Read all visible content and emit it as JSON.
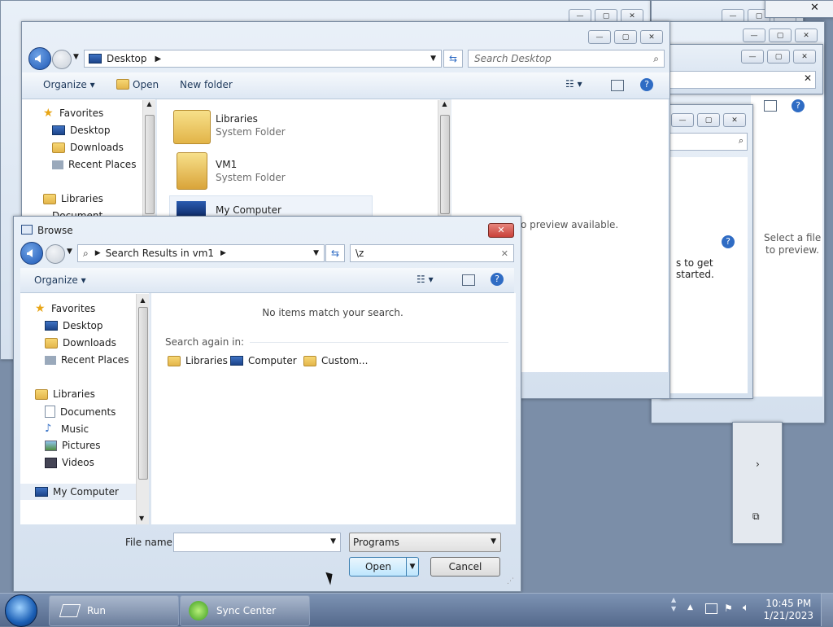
{
  "back_window": {
    "address": "Desktop",
    "search_placeholder": "Search Desktop",
    "toolbar": {
      "organize": "Organize",
      "open": "Open",
      "new_folder": "New folder"
    },
    "nav": {
      "favorites": "Favorites",
      "desktop": "Desktop",
      "downloads": "Downloads",
      "recent": "Recent Places",
      "libraries": "Libraries",
      "documents_partial": "Document"
    },
    "files": [
      {
        "name": "Libraries",
        "type": "System Folder"
      },
      {
        "name": "VM1",
        "type": "System Folder"
      },
      {
        "name": "My Computer",
        "type": ""
      }
    ],
    "preview_text": "No preview available."
  },
  "side_windows": {
    "select_file_1": "Select a file",
    "select_file_2": "to preview.",
    "get_started": "s to get started."
  },
  "browse_dialog": {
    "title": "Browse",
    "breadcrumb": "Search Results in vm1",
    "search_value": "\\z",
    "toolbar": {
      "organize": "Organize"
    },
    "nav": {
      "favorites": "Favorites",
      "desktop": "Desktop",
      "downloads": "Downloads",
      "recent": "Recent Places",
      "libraries": "Libraries",
      "documents": "Documents",
      "music": "Music",
      "pictures": "Pictures",
      "videos": "Videos",
      "my_computer": "My Computer"
    },
    "no_items": "No items match your search.",
    "search_again": "Search again in:",
    "search_locations": [
      "Libraries",
      "Computer",
      "Custom..."
    ],
    "file_name_label": "File name:",
    "file_name_value": "",
    "file_type": "Programs",
    "open_button": "Open",
    "cancel_button": "Cancel"
  },
  "taskbar": {
    "items": [
      "Run",
      "Sync Center"
    ],
    "time": "10:45 PM",
    "date": "1/21/2023"
  },
  "colors": {
    "accent": "#1e58b5",
    "taskbar": "#54698c",
    "close": "#c9413a"
  }
}
